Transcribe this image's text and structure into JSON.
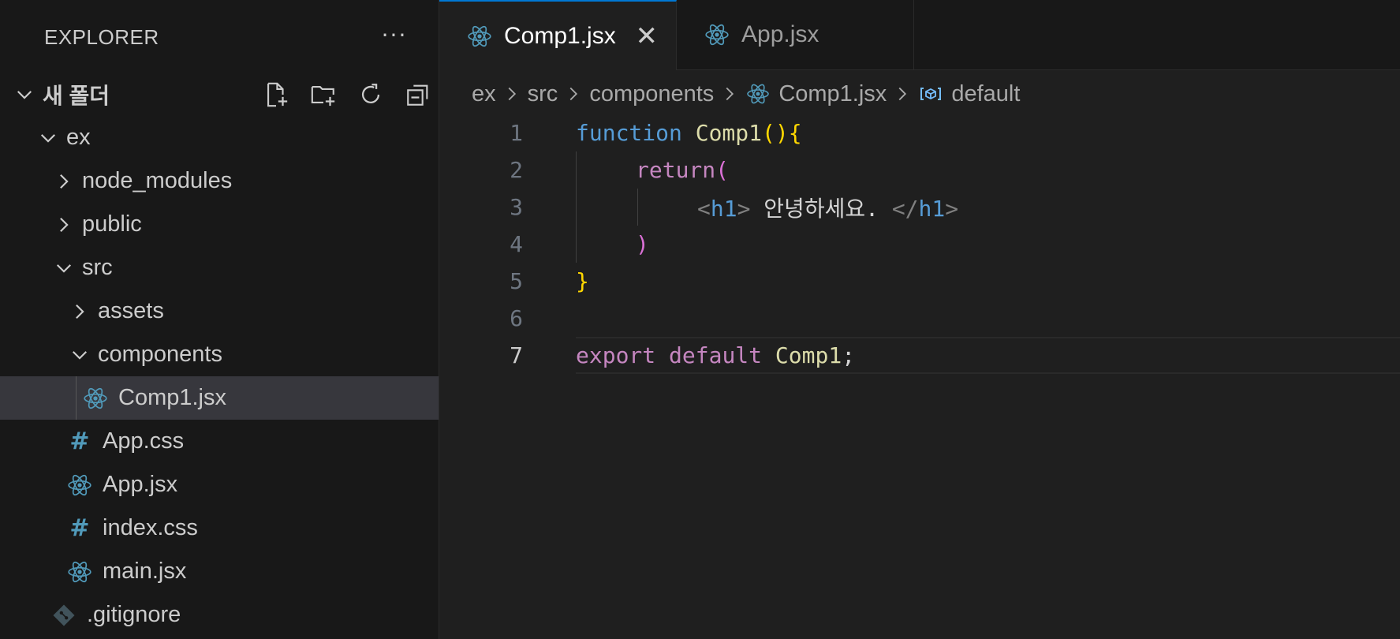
{
  "explorer": {
    "title": "EXPLORER",
    "more": "···",
    "root": "새 폴더",
    "items": [
      {
        "label": "ex",
        "type": "folder",
        "open": true
      },
      {
        "label": "node_modules",
        "type": "folder",
        "open": false
      },
      {
        "label": "public",
        "type": "folder",
        "open": false
      },
      {
        "label": "src",
        "type": "folder",
        "open": true
      },
      {
        "label": "assets",
        "type": "folder",
        "open": false
      },
      {
        "label": "components",
        "type": "folder",
        "open": true
      },
      {
        "label": "Comp1.jsx",
        "type": "react-file",
        "selected": true
      },
      {
        "label": "App.css",
        "type": "css-file"
      },
      {
        "label": "App.jsx",
        "type": "react-file"
      },
      {
        "label": "index.css",
        "type": "css-file"
      },
      {
        "label": "main.jsx",
        "type": "react-file"
      },
      {
        "label": ".gitignore",
        "type": "git-file"
      }
    ]
  },
  "tabs": [
    {
      "label": "Comp1.jsx",
      "active": true,
      "close": "✕"
    },
    {
      "label": "App.jsx",
      "active": false
    }
  ],
  "breadcrumb": {
    "parts": [
      "ex",
      "src",
      "components",
      "Comp1.jsx",
      "default"
    ]
  },
  "editor": {
    "line_numbers": [
      "1",
      "2",
      "3",
      "4",
      "5",
      "6",
      "7"
    ],
    "current_line": 7,
    "lines": {
      "l1": {
        "kw": "function",
        "name": "Comp1",
        "paren": "()",
        "brace": "{"
      },
      "l2": {
        "kw": "return",
        "paren": "("
      },
      "l3": {
        "open_lt": "<",
        "open_tag": "h1",
        "open_gt": ">",
        "text": " 안녕하세요. ",
        "close_lt": "</",
        "close_tag": "h1",
        "close_gt": ">"
      },
      "l4": {
        "paren": ")"
      },
      "l5": {
        "brace": "}"
      },
      "l7": {
        "kw1": "export",
        "kw2": "default",
        "name": "Comp1",
        "semi": ";"
      }
    }
  },
  "colors": {
    "accent": "#0078d4",
    "react_icon": "#519aba",
    "keyword_blue": "#569cd6",
    "keyword_pink": "#c586c0",
    "function_yellow": "#dcdcaa",
    "bracket_gold": "#ffd700"
  }
}
